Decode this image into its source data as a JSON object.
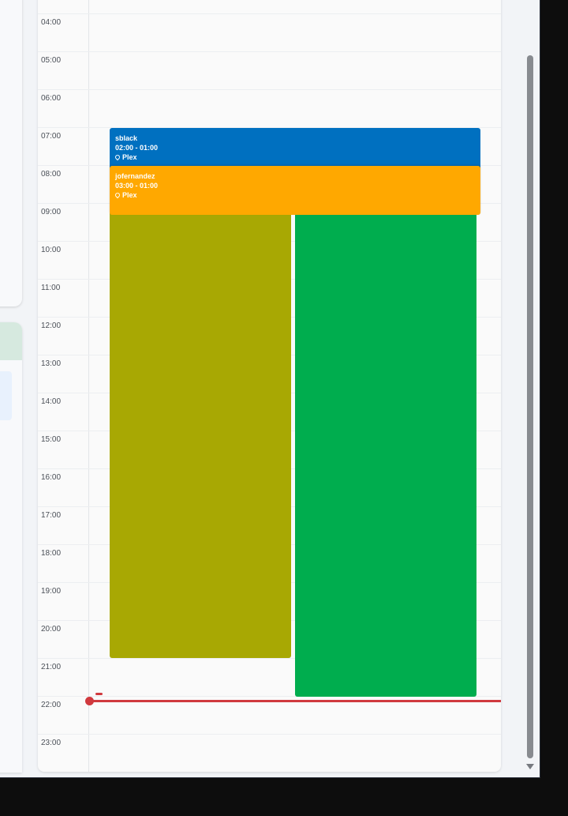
{
  "calendar": {
    "hours": [
      "04:00",
      "05:00",
      "06:00",
      "07:00",
      "08:00",
      "09:00",
      "10:00",
      "11:00",
      "12:00",
      "13:00",
      "14:00",
      "15:00",
      "16:00",
      "17:00",
      "18:00",
      "19:00",
      "20:00",
      "21:00",
      "22:00",
      "23:00"
    ]
  },
  "events": [
    {
      "id": "sblack",
      "title": "sblack",
      "time": "02:00 - 01:00",
      "location": "Plex",
      "color": "#0070c0",
      "icon": "location-pin-icon"
    },
    {
      "id": "jofernandez",
      "title": "jofernandez",
      "time": "03:00 - 01:00",
      "location": "Plex",
      "color": "#ffa800",
      "icon": "location-pin-icon"
    },
    {
      "id": "olive-block",
      "title": "",
      "color": "#a8a803"
    },
    {
      "id": "green-block",
      "title": "",
      "color": "#00ad4e"
    }
  ],
  "now_indicator": {
    "color": "#d0393e"
  }
}
